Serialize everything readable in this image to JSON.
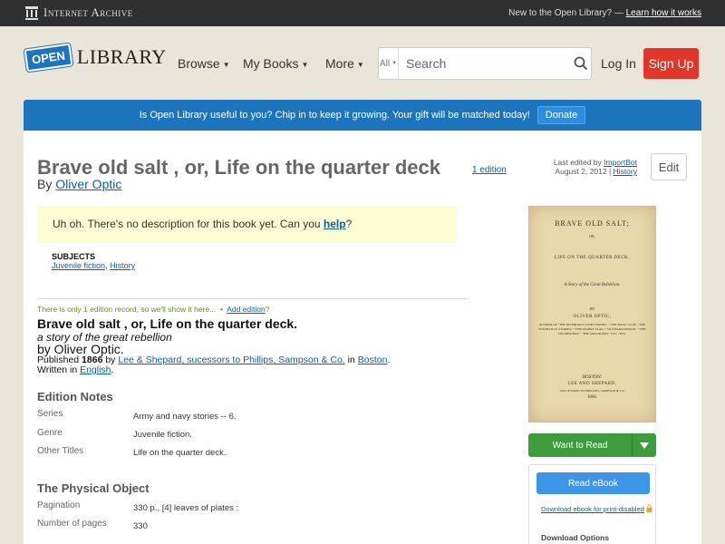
{
  "ia_bar": {
    "logo_text": "Internet Archive",
    "prompt_text": "New to the Open Library? —",
    "prompt_link": "Learn how it works"
  },
  "header": {
    "logo_open": "OPEN",
    "logo_library": "LIBRARY",
    "nav": [
      {
        "label": "Browse"
      },
      {
        "label": "My Books"
      },
      {
        "label": "More"
      }
    ],
    "search_scope": "All",
    "search_placeholder": "Search",
    "login_label": "Log In",
    "signup_label": "Sign Up"
  },
  "donate": {
    "message": "Is Open Library useful to you? Chip in to keep it growing. Your gift will be matched today!",
    "button": "Donate"
  },
  "book": {
    "title": "Brave old salt , or, Life on the quarter deck",
    "edition_count": "1 edition",
    "by_prefix": "By",
    "author": "Oliver Optic",
    "last_edited_prefix": "Last edited by",
    "last_edited_by": "ImportBot",
    "last_edited_date": "August 2, 2012",
    "history_link": "History",
    "edit_label": "Edit",
    "no_desc_text": "Uh oh. There's no description for this book yet. Can you",
    "no_desc_link": "help",
    "no_desc_end": "?",
    "subjects_heading": "SUBJECTS",
    "subjects": [
      "Juvenile fiction",
      "History"
    ],
    "subjects_sep": ","
  },
  "edition": {
    "only_one_text": "There is only 1 edition record, so we'll show it here...",
    "bullet": "•",
    "add_edition": "Add edition",
    "add_edition_q": "?",
    "title": "Brave old salt , or, Life on the quarter deck.",
    "subtitle": "a story of the great rebellion",
    "by_statement": "by Oliver Optic.",
    "published_prefix": "Published",
    "year": "1866",
    "by_word": "by",
    "publisher": "Lee & Shepard, sucessors to Phillips, Sampson & Co.",
    "in_word": "in",
    "place": "Boston",
    "period": ".",
    "written_prefix": "Written in",
    "language": "English",
    "written_period": "."
  },
  "edition_notes": {
    "heading": "Edition Notes",
    "rows": [
      {
        "key": "Series",
        "value": "Army and navy stories -- 6."
      },
      {
        "key": "Genre",
        "value": "Juvenile fiction."
      },
      {
        "key": "Other Titles",
        "value": "Life on the quarter deck."
      }
    ]
  },
  "physical": {
    "heading": "The Physical Object",
    "rows": [
      {
        "key": "Pagination",
        "value": "330 p., [4] leaves of plates :"
      },
      {
        "key": "Number of pages",
        "value": "330"
      }
    ]
  },
  "cover": {
    "line1": "BRAVE OLD SALT;",
    "line2": "OR,",
    "line3": "LIFE ON THE QUARTER DECK.",
    "line4": "A Story of the Great Rebellion.",
    "line5": "BY",
    "line6": "OLIVER OPTIC,",
    "line7": "AUTHOR OF \"THE RIVERDALE STORY BOOKS,\" \"THE BOAT CLUB,\" \"THE WOODVILLE STORIES,\" \"THE STARRY FLAG,\" \"OUTWARD BOUND,\" \"THE SOLDIER BOY,\" \"THE SAILOR BOY,\" ETC., ETC.",
    "line8": "BOSTON:",
    "line9": "LEE AND SHEPARD,",
    "line10": "SUCCESSORS TO PHILLIPS, SAMPSON & CO.",
    "line11": "1866."
  },
  "sidebar": {
    "want_to_read": "Want to Read",
    "read_ebook": "Read eBook",
    "download_print": "Download ebook for print-disabled",
    "download_options": "Download Options"
  },
  "colors": {
    "donate_blue": "#1c75bc",
    "signup_red": "#e1372a",
    "want_green": "#3f9c3c",
    "read_blue": "#3d95e8"
  }
}
